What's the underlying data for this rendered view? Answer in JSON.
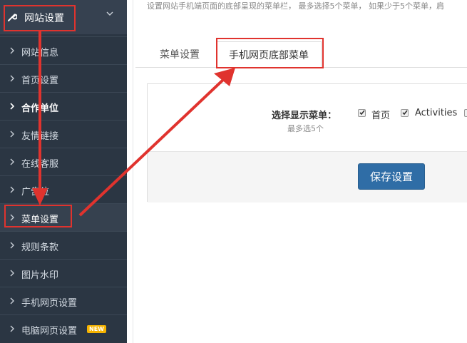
{
  "sidebar": {
    "header": {
      "title": "网站设置"
    },
    "items": [
      {
        "label": "网站信息"
      },
      {
        "label": "首页设置"
      },
      {
        "label": "合作单位"
      },
      {
        "label": "友情链接"
      },
      {
        "label": "在线客服"
      },
      {
        "label": "广告位"
      },
      {
        "label": "菜单设置"
      },
      {
        "label": "规则条款"
      },
      {
        "label": "图片水印"
      },
      {
        "label": "手机网页设置"
      },
      {
        "label": "电脑网页设置",
        "badge": "NEW"
      }
    ]
  },
  "hint": "设置网站手机端页面的底部呈现的菜单栏， 最多选择5个菜单， 如果少于5个菜单，肩",
  "tabs": [
    {
      "label": "菜单设置"
    },
    {
      "label": "手机网页底部菜单"
    }
  ],
  "form": {
    "field_label": "选择显示菜单：",
    "field_help": "最多选5个",
    "options": [
      {
        "label": "首页",
        "checked": true
      },
      {
        "label": "Activities",
        "checked": true
      }
    ],
    "save_label": "保存设置"
  },
  "colors": {
    "sidebar_bg": "#2b3643",
    "accent": "#2f6da6",
    "annotation": "#e0332e",
    "badge": "#f5b300"
  }
}
